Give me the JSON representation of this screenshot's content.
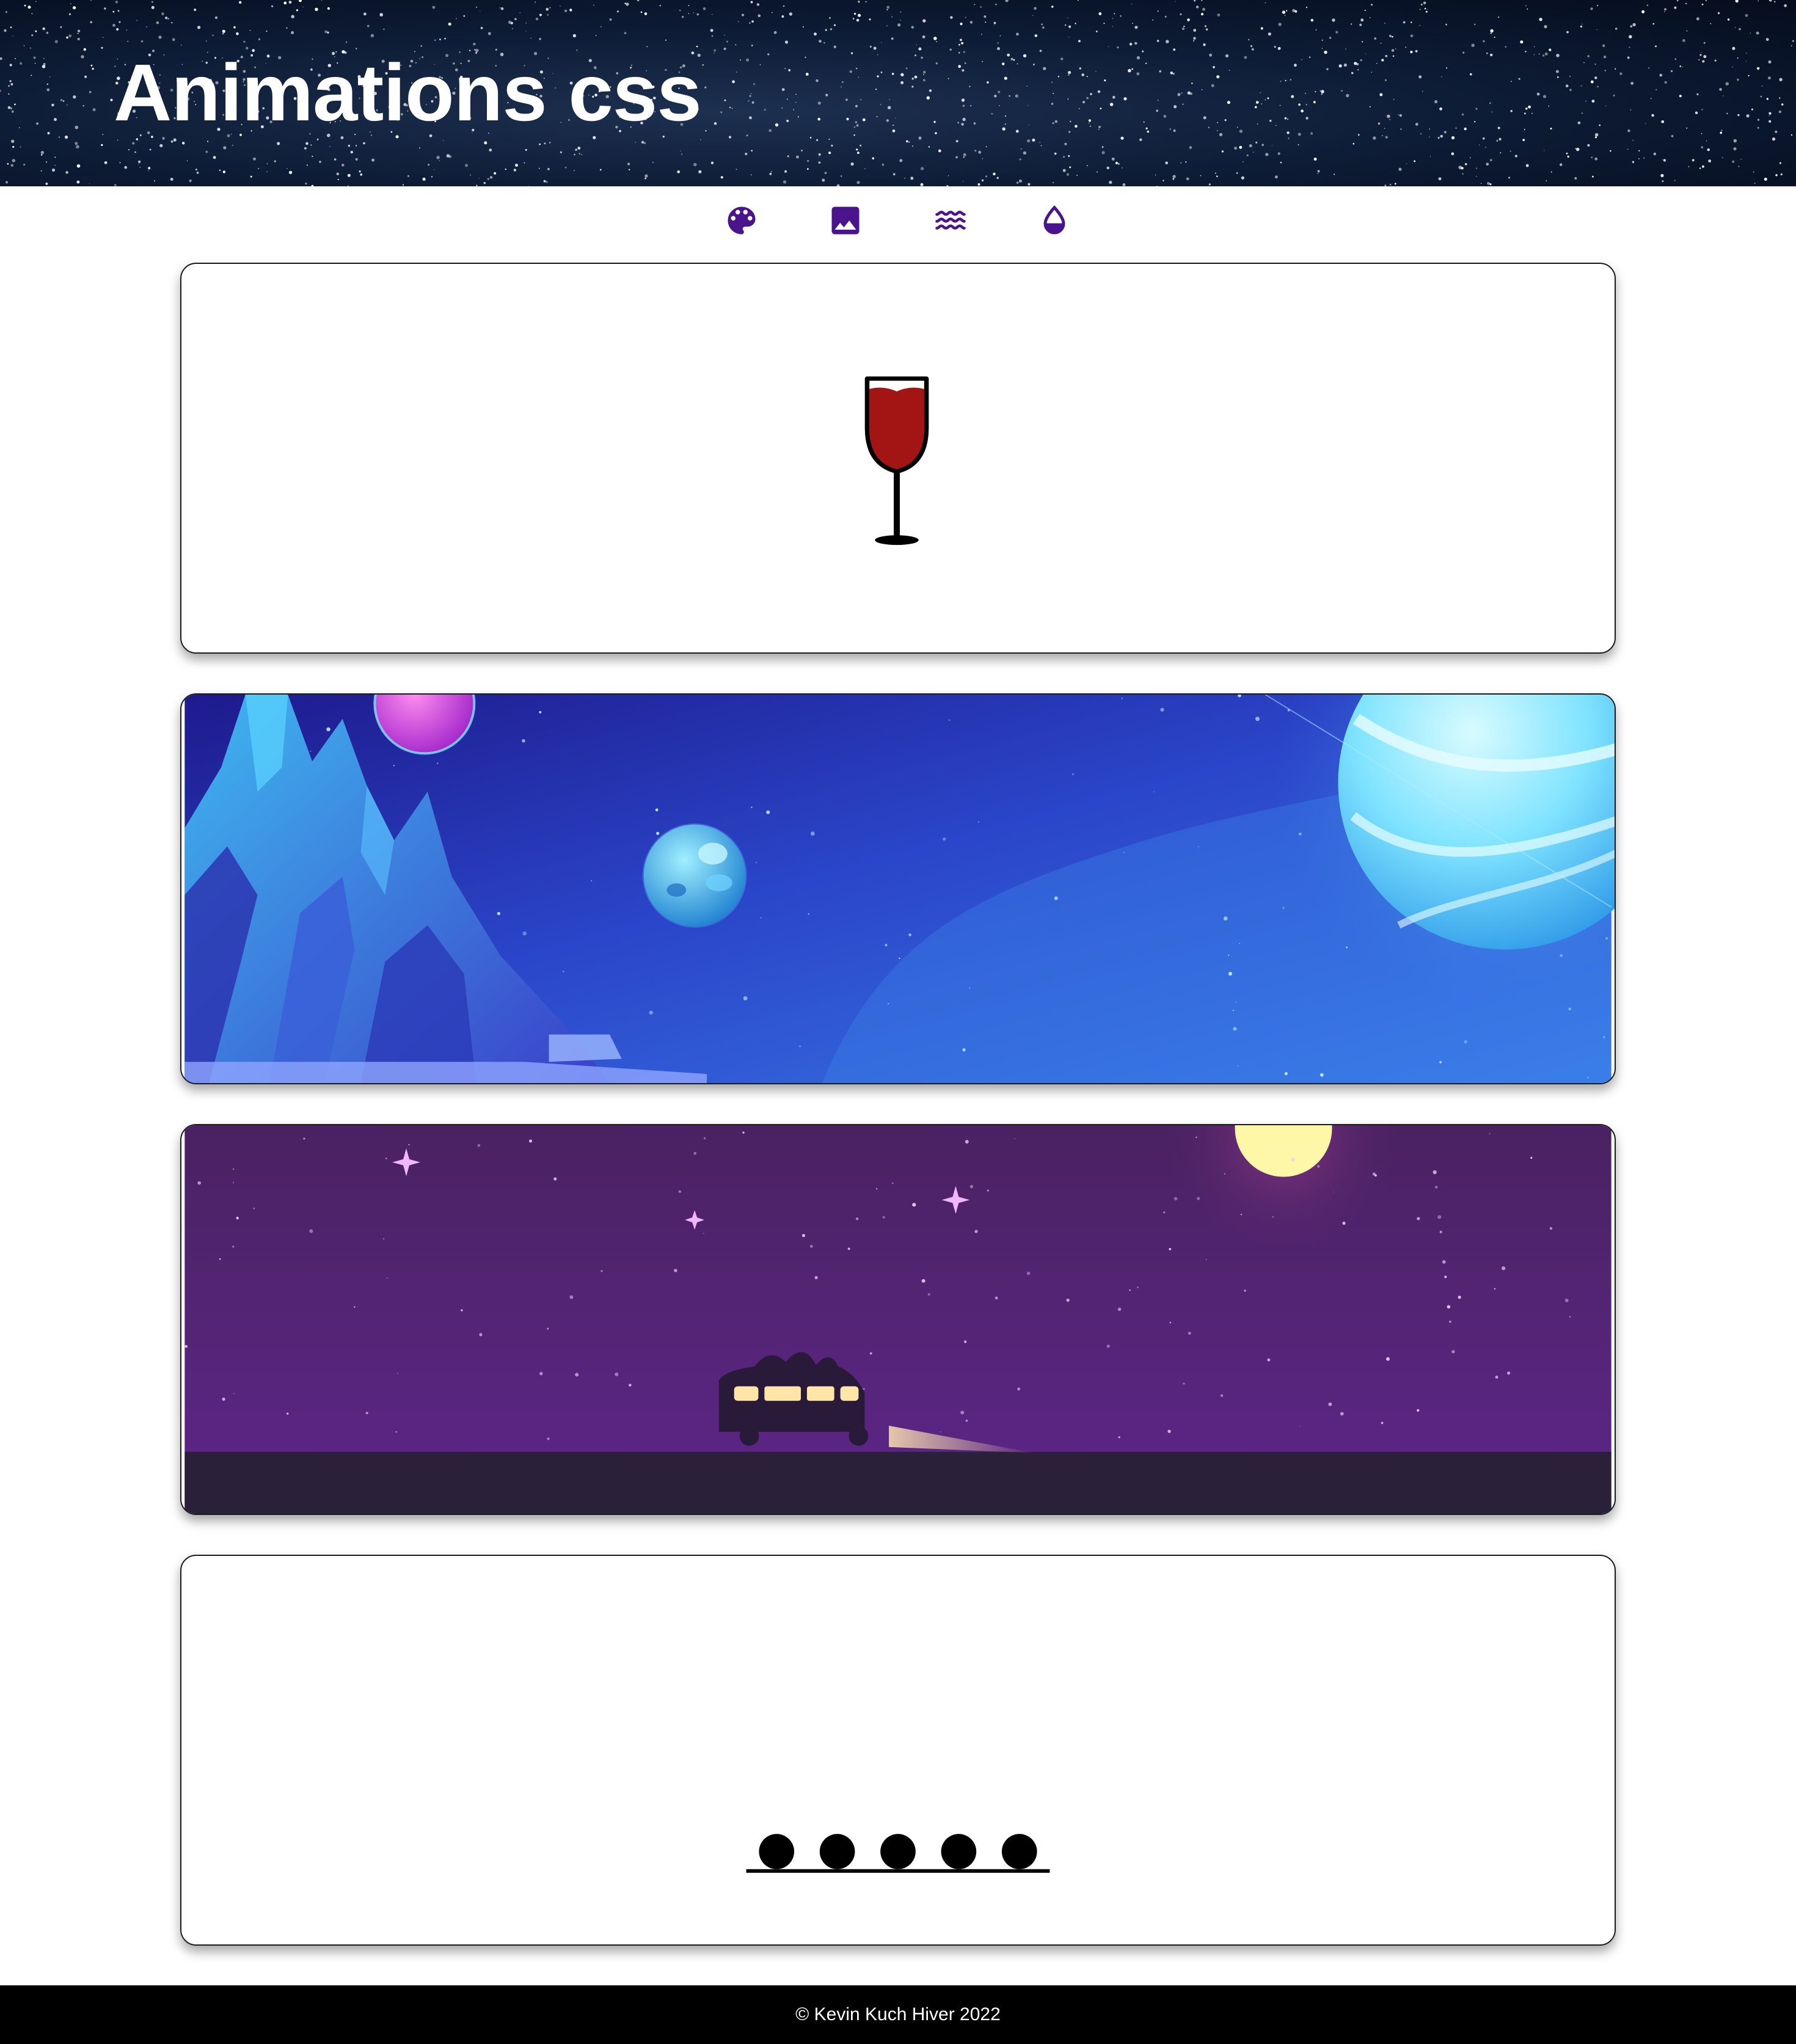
{
  "header": {
    "title": "Animations css"
  },
  "nav": {
    "items": [
      {
        "icon": "palette-icon"
      },
      {
        "icon": "image-icon"
      },
      {
        "icon": "waves-icon"
      },
      {
        "icon": "water-drop-icon"
      }
    ],
    "icon_color": "#4a148c"
  },
  "cards": [
    {
      "scene": "wine-glass",
      "fill_color": "#a31515"
    },
    {
      "scene": "space-planets",
      "background": "#2a3fc4"
    },
    {
      "scene": "night-van",
      "background": "#5a2282"
    },
    {
      "scene": "bouncing-balls",
      "ball_count": 5
    }
  ],
  "footer": {
    "text": "© Kevin Kuch Hiver 2022"
  }
}
